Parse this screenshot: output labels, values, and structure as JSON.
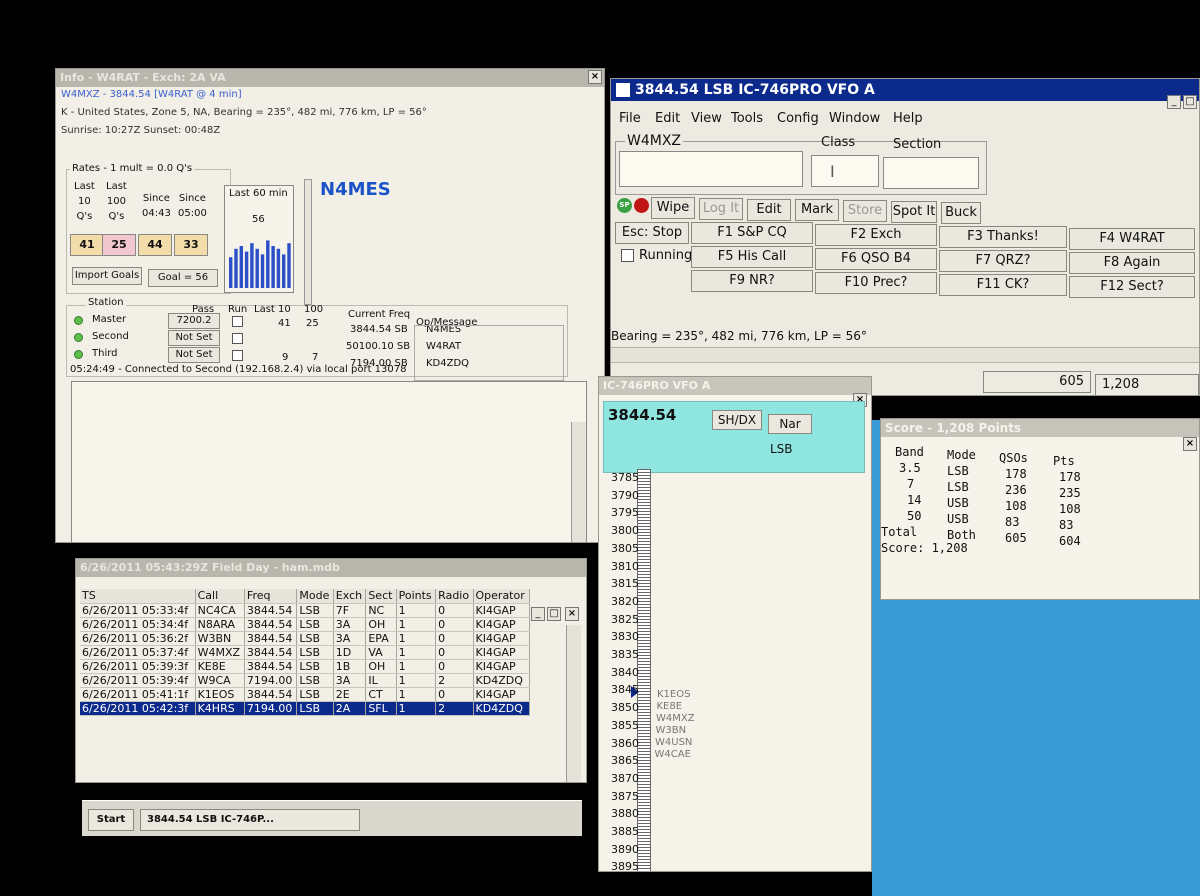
{
  "info": {
    "title": "Info - W4RAT - Exch: 2A VA",
    "call_line": "W4MXZ - 3844.54 [W4RAT @ 4 min]",
    "location_line": "K - United States, Zone 5, NA, Bearing = 235°, 482 mi, 776 km, LP = 56°",
    "sun_line": "Sunrise: 10:27Z   Sunset: 00:48Z",
    "rates_label": "Rates - 1 mult = 0.0 Q's",
    "rate_headers": [
      "Last\n10\nQ's",
      "Last\n100\nQ's",
      "Since\n04:43",
      "Since\n05:00"
    ],
    "rate_values": [
      "41",
      "25",
      "44",
      "33"
    ],
    "last60_label": "Last 60 min",
    "last60_value": "56",
    "last60_bars": [
      0.55,
      0.7,
      0.75,
      0.65,
      0.8,
      0.7,
      0.6,
      0.85,
      0.75,
      0.7,
      0.6,
      0.8
    ],
    "operator_call": "N4MES",
    "import_goals": "Import Goals",
    "goal": "Goal = 56",
    "station_headers": {
      "station": "Station",
      "pass": "Pass",
      "run": "Run",
      "last10": "Last 10",
      "last100": "100",
      "freq": "Current Freq",
      "op": "Op/Message"
    },
    "stations": [
      {
        "name": "Master",
        "pass": "7200.2",
        "last10": "41",
        "last100": "25",
        "freq": "3844.54 SB",
        "op": "N4MES"
      },
      {
        "name": "Second",
        "pass": "Not Set",
        "last10": "",
        "last100": "",
        "freq": "50100.10 SB",
        "op": "W4RAT"
      },
      {
        "name": "Third",
        "pass": "Not Set",
        "last10": "9",
        "last100": "7",
        "freq": "7194.00 SB",
        "op": "KD4ZDQ"
      }
    ],
    "status": "05:24:49 - Connected to Second (192.168.2.4) via local port 13078"
  },
  "log": {
    "title": "6/26/2011 05:43:29Z Field Day - ham.mdb",
    "columns": [
      "TS",
      "Call",
      "Freq",
      "Mode",
      "Exch",
      "Sect",
      "Points",
      "Radio",
      "Operator"
    ],
    "rows": [
      [
        "6/26/2011 05:33:4f",
        "NC4CA",
        "3844.54",
        "LSB",
        "7F",
        "NC",
        "1",
        "0",
        "KI4GAP"
      ],
      [
        "6/26/2011 05:34:4f",
        "N8ARA",
        "3844.54",
        "LSB",
        "3A",
        "OH",
        "1",
        "0",
        "KI4GAP"
      ],
      [
        "6/26/2011 05:36:2f",
        "W3BN",
        "3844.54",
        "LSB",
        "3A",
        "EPA",
        "1",
        "0",
        "KI4GAP"
      ],
      [
        "6/26/2011 05:37:4f",
        "W4MXZ",
        "3844.54",
        "LSB",
        "1D",
        "VA",
        "1",
        "0",
        "KI4GAP"
      ],
      [
        "6/26/2011 05:39:3f",
        "KE8E",
        "3844.54",
        "LSB",
        "1B",
        "OH",
        "1",
        "0",
        "KI4GAP"
      ],
      [
        "6/26/2011 05:39:4f",
        "W9CA",
        "7194.00",
        "LSB",
        "3A",
        "IL",
        "1",
        "2",
        "KD4ZDQ"
      ],
      [
        "6/26/2011 05:41:1f",
        "K1EOS",
        "3844.54",
        "LSB",
        "2E",
        "CT",
        "1",
        "0",
        "KI4GAP"
      ],
      [
        "6/26/2011 05:42:3f",
        "K4HRS",
        "7194.00",
        "LSB",
        "2A",
        "SFL",
        "1",
        "2",
        "KD4ZDQ"
      ]
    ]
  },
  "taskbar": {
    "start": "Start",
    "task": "3844.54 LSB IC-746P..."
  },
  "entry": {
    "title": "3844.54 LSB IC-746PRO VFO A",
    "menu": [
      "File",
      "Edit",
      "View",
      "Tools",
      "Config",
      "Window",
      "Help"
    ],
    "call_label": "W4MXZ",
    "class_label": "Class",
    "section_label": "Section",
    "class_value": "I",
    "buttons": [
      "Wipe",
      "Log It",
      "Edit",
      "Mark",
      "Store",
      "Spot It",
      "Buck"
    ],
    "esc_stop": "Esc: Stop",
    "running": "Running",
    "fkeys": [
      "F1 S&P CQ",
      "F2 Exch",
      "F3 Thanks!",
      "F4 W4RAT",
      "F5 His Call",
      "F6 QSO B4",
      "F7 QRZ?",
      "F8 Again",
      "F9 NR?",
      "F10 Prec?",
      "F11 CK?",
      "F12 Sect?"
    ],
    "bearing": "Bearing = 235°, 482 mi, 776 km, LP = 56°",
    "count_qsos": "605",
    "count_points": "1,208"
  },
  "bandmap": {
    "title": "IC-746PRO VFO A",
    "freq": "3844.54",
    "shdx": "SH/DX",
    "nar": "Nar",
    "mode": "LSB",
    "ticks": [
      "3785",
      "3790",
      "3795",
      "3800",
      "3805",
      "3810",
      "3815",
      "3820",
      "3825",
      "3830",
      "3835",
      "3840",
      "3845",
      "3850",
      "3855",
      "3860",
      "3865",
      "3870",
      "3875",
      "3880",
      "3885",
      "3890",
      "3895"
    ],
    "spots": [
      "K1EOS",
      "KE8E",
      "W4MXZ",
      "W3BN",
      "W4USN",
      "W4CAE"
    ]
  },
  "score": {
    "title": "Score - 1,208 Points",
    "headers": [
      "Band",
      "Mode",
      "QSOs",
      "Pts"
    ],
    "rows": [
      [
        "3.5",
        "LSB",
        "178",
        "178"
      ],
      [
        "7",
        "LSB",
        "236",
        "235"
      ],
      [
        "14",
        "USB",
        "108",
        "108"
      ],
      [
        "50",
        "USB",
        "83",
        "83"
      ],
      [
        "Total",
        "Both",
        "605",
        "604"
      ]
    ],
    "score_label": "Score: 1,208"
  },
  "colors": {
    "title_active": "#0c2a8c",
    "desktop": "#3a9ad6",
    "bandmap_header": "#8fe6e0",
    "callsign_blue": "#1a54c8"
  }
}
